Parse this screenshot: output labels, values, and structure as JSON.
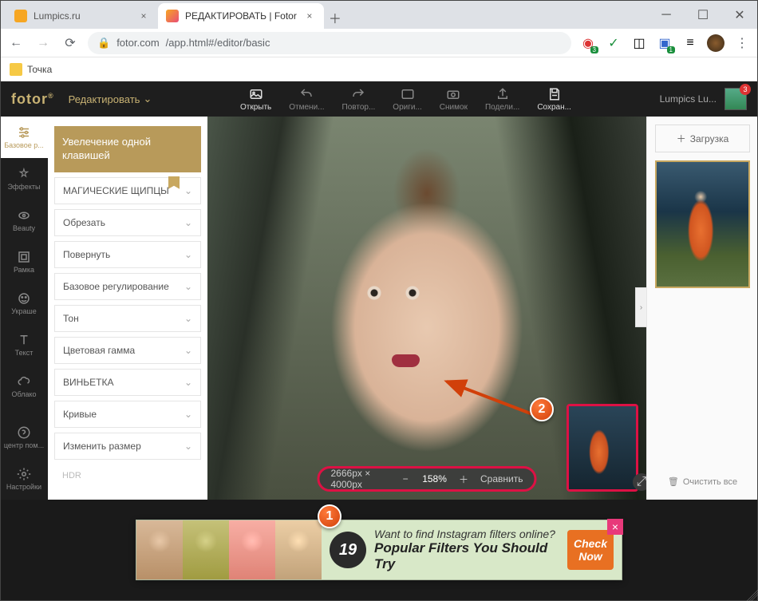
{
  "browser": {
    "tabs": [
      {
        "title": "Lumpics.ru"
      },
      {
        "title": "РЕДАКТИРОВАТЬ | Fotor"
      }
    ],
    "url_host": "fotor.com",
    "url_path": "/app.html#/editor/basic",
    "bookmark": "Точка",
    "ext_badge1": "3",
    "ext_badge2": "1"
  },
  "header": {
    "logo": "fotor",
    "edit": "Редактировать",
    "tools": {
      "open": "Открыть",
      "undo": "Отмени...",
      "redo": "Повтор...",
      "original": "Ориги...",
      "snapshot": "Снимок",
      "share": "Подели...",
      "save": "Сохран..."
    },
    "user": "Lumpics Lu...",
    "notif": "3"
  },
  "iconbar": {
    "basic": "Базовое р...",
    "effects": "Эффекты",
    "beauty": "Beauty",
    "frame": "Рамка",
    "stickers": "Украше",
    "text": "Текст",
    "cloud": "Облако",
    "help": "центр пом...",
    "settings": "Настройки"
  },
  "options": {
    "enhance": "Увелечение одной клавишей",
    "magic": "МАГИЧЕСКИЕ ЩИПЦЫ",
    "crop": "Обрезать",
    "rotate": "Повернуть",
    "basic_adj": "Базовое регулирование",
    "tone": "Тон",
    "color": "Цветовая гамма",
    "vignette": "ВИНЬЕТКА",
    "curves": "Кривые",
    "resize": "Изменить размер",
    "hdr": "HDR"
  },
  "zoombar": {
    "dims": "2666px × 4000px",
    "zoom": "158%",
    "compare": "Сравнить"
  },
  "rpanel": {
    "upload": "Загрузка",
    "clear": "Очистить все"
  },
  "ad": {
    "num": "19",
    "line1": "Want to find Instagram filters online?",
    "line2": "Popular Filters You Should Try",
    "cta1": "Check",
    "cta2": "Now"
  },
  "callouts": {
    "c1": "1",
    "c2": "2"
  }
}
